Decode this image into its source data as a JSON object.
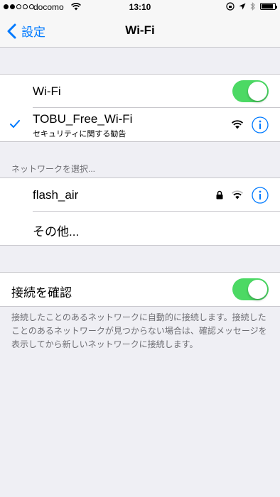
{
  "status_bar": {
    "carrier": "docomo",
    "time": "13:10",
    "signal_bars_filled": 2,
    "signal_bars_total": 5,
    "battery_level": 0.9
  },
  "nav": {
    "back_label": "設定",
    "title": "Wi-Fi"
  },
  "wifi_toggle": {
    "label": "Wi-Fi",
    "on": true
  },
  "connected_network": {
    "name": "TOBU_Free_Wi-Fi",
    "subtitle": "セキュリティに関する勧告"
  },
  "networks_section": {
    "header": "ネットワークを選択...",
    "items": [
      {
        "name": "flash_air",
        "locked": true
      },
      {
        "name": "その他..."
      }
    ]
  },
  "ask_join": {
    "label": "接続を確認",
    "on": true,
    "description": "接続したことのあるネットワークに自動的に接続します。接続したことのあるネットワークが見つからない場合は、確認メッセージを表示してから新しいネットワークに接続します。"
  },
  "colors": {
    "accent": "#007aff",
    "toggle_on": "#4cd964",
    "background": "#efeff4"
  }
}
